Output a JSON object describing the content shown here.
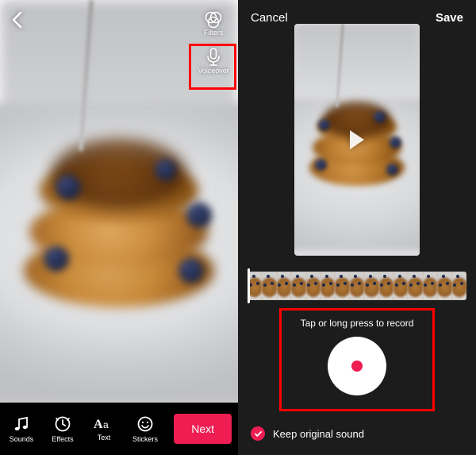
{
  "left": {
    "side_tools": {
      "filters_label": "Filters",
      "voiceover_label": "Voiceover"
    },
    "bottom": {
      "sounds_label": "Sounds",
      "effects_label": "Effects",
      "text_label": "Text",
      "stickers_label": "Stickers",
      "next_label": "Next"
    }
  },
  "right": {
    "header": {
      "cancel_label": "Cancel",
      "save_label": "Save"
    },
    "record_hint": "Tap or long press to record",
    "keep_sound_label": "Keep original sound",
    "keep_sound_checked": true,
    "timeline_thumb_count": 15
  },
  "highlights": {
    "voiceover_button": true,
    "record_area": true
  },
  "colors": {
    "accent": "#ee1d52",
    "highlight_border": "#ff0000",
    "dark_bg": "#1c1c1c"
  }
}
